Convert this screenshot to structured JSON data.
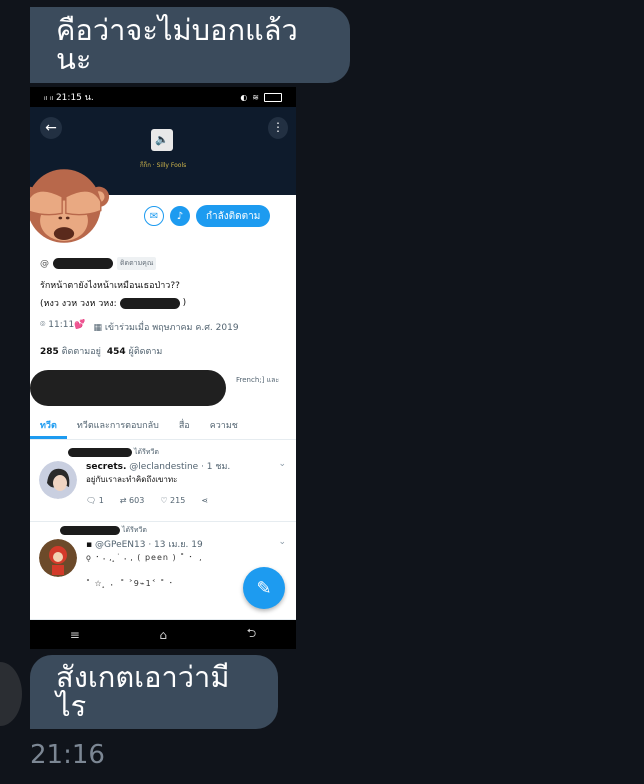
{
  "messages": {
    "top_text": "คือว่าจะไม่บอกแล้วนะ",
    "bottom_text": "สังเกตเอาว่ามีไร",
    "timestamp": "21:16"
  },
  "screenshot": {
    "status_time": "21:15 น.",
    "status_signal": "ᵢₗ ᵢₗ",
    "banner_text": "ก็ก็ก · Silly Fools",
    "follow_button": "กำลังติดตาม",
    "follows_you": "ติดตามคุณ",
    "bio_line1": "รักหน้าตายังไงหน้าเหมือนเธอป่าว??",
    "bio_line2_prefix": "(หงว งวห วงห วหง:",
    "bio_line2_suffix": ")",
    "location": "11:11💕",
    "joined": "เข้าร่วมเมื่อ พฤษภาคม ค.ศ. 2019",
    "following_count": "285",
    "following_label": "ติดตามอยู่",
    "followers_count": "454",
    "followers_label": "ผู้ติดตาม",
    "followed_by_tail": "French;] และ",
    "tabs": [
      "ทวีต",
      "ทวีตและการตอบกลับ",
      "สื่อ",
      "ความช"
    ],
    "tweets": [
      {
        "retweet_label": "ได้รีทวีต",
        "name": "secrets.",
        "handle": "@leclandestine · 1 ชม.",
        "body": "อยู่กับเราละทำคิดถึงเขาทะ",
        "replies": "1",
        "retweets": "603",
        "likes": "215"
      },
      {
        "retweet_label": "ได้รีทวีต",
        "handle": "@GPeEN13 · 13 เม.ย. 19",
        "line1": "ǫ ⠂⠄, ̥ ͘ ⠄, ( peen ) ˚ ⠂ ,",
        "line2": "˚ ☆ ̥ ⠄ ˚ ˃9⌁1˂ ˚ ⠂"
      }
    ]
  }
}
